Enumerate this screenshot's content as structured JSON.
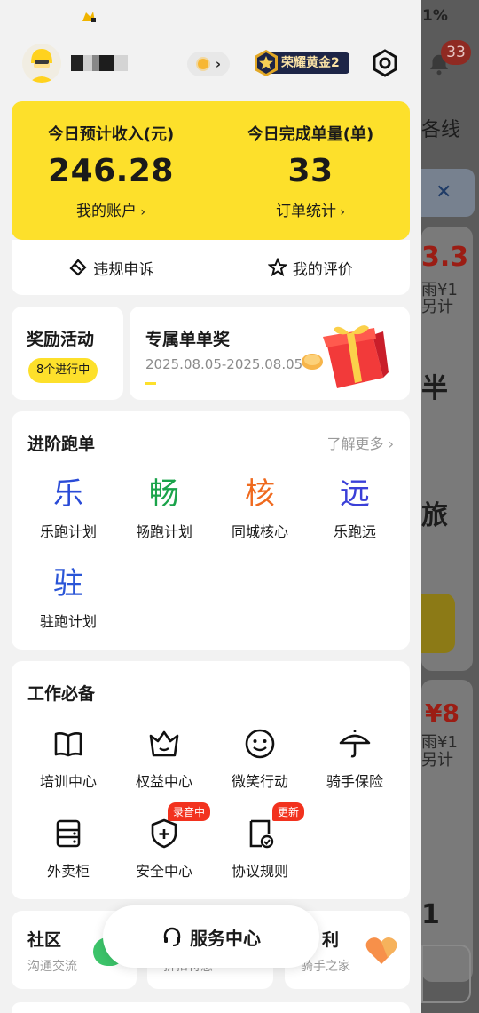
{
  "status_bar": {
    "battery_fragment": "1%"
  },
  "header": {
    "user_name": "",
    "level_badge": "荣耀黄金2",
    "notification_count": "33"
  },
  "earnings": {
    "income_label": "今日预计收入(元)",
    "income_value": "246.28",
    "account_link": "我的账户",
    "orders_label": "今日完成单量(单)",
    "orders_value": "33",
    "orders_link": "订单统计",
    "appeal_label": "违规申诉",
    "rating_label": "我的评价"
  },
  "rewards": {
    "title": "奖励活动",
    "pill": "8个进行中"
  },
  "exclusive": {
    "title": "专属单单奖",
    "date_range": "2025.08.05-2025.08.05"
  },
  "advanced": {
    "title": "进阶跑单",
    "more": "了解更多",
    "items": [
      {
        "glyph": "乐",
        "label": "乐跑计划",
        "color": "#2a4bd7"
      },
      {
        "glyph": "畅",
        "label": "畅跑计划",
        "color": "#1aa34a"
      },
      {
        "glyph": "核",
        "label": "同城核心",
        "color": "#ef6a1f"
      },
      {
        "glyph": "远",
        "label": "乐跑远",
        "color": "#3a3fd8"
      },
      {
        "glyph": "驻",
        "label": "驻跑计划",
        "color": "#2a55d7"
      }
    ]
  },
  "essentials": {
    "title": "工作必备",
    "items": [
      {
        "icon": "book-icon",
        "label": "培训中心"
      },
      {
        "icon": "crown-icon",
        "label": "权益中心"
      },
      {
        "icon": "smile-icon",
        "label": "微笑行动"
      },
      {
        "icon": "umbrella-icon",
        "label": "骑手保险"
      },
      {
        "icon": "locker-icon",
        "label": "外卖柜"
      },
      {
        "icon": "shield-plus-icon",
        "label": "安全中心",
        "tag": "录音中"
      },
      {
        "icon": "document-check-icon",
        "label": "协议规则",
        "tag": "更新"
      }
    ]
  },
  "bottom": {
    "community_title": "社区",
    "community_sub": "沟通交流",
    "middle_sub": "折扣特惠",
    "welfare_title": "利",
    "welfare_sub": "骑手之家",
    "service_center": "服务中心"
  },
  "background_app": {
    "route_fragment": "各线",
    "price_1": "3.3",
    "sub_1a": "雨¥1",
    "sub_1b": "另计",
    "text_ban": "半",
    "text_lv": "旅",
    "price_2": "¥8",
    "sub_2a": "雨¥1",
    "sub_2b": "另计",
    "digit": "1"
  },
  "colors": {
    "brand_yellow": "#fde02b",
    "badge_navy": "#1d2547",
    "tag_red": "#f2321e"
  }
}
